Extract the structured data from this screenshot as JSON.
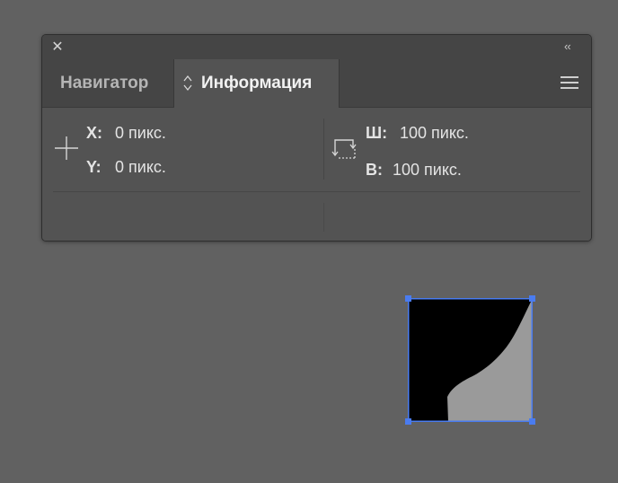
{
  "panel": {
    "tabs": [
      {
        "label": "Навигатор",
        "active": false
      },
      {
        "label": "Информация",
        "active": true
      }
    ]
  },
  "info": {
    "x_label": "X:",
    "x_value": "0 пикс.",
    "y_label": "Y:",
    "y_value": "0 пикс.",
    "w_label": "Ш:",
    "w_value": "100 пикс.",
    "h_label": "В:",
    "h_value": "100 пикс."
  },
  "colors": {
    "canvas_bg": "#616161",
    "panel_bg": "#535353",
    "tabbar_bg": "#454545",
    "selection": "#4a7cf0",
    "shape_dark": "#000000",
    "shape_light": "#9a9a9a"
  },
  "icons": {
    "close": "close-icon",
    "collapse": "double-chevron-left-icon",
    "menu": "hamburger-menu-icon",
    "tab_updown": "up-down-arrows-icon",
    "position": "crosshair-icon",
    "size": "selection-size-icon"
  }
}
